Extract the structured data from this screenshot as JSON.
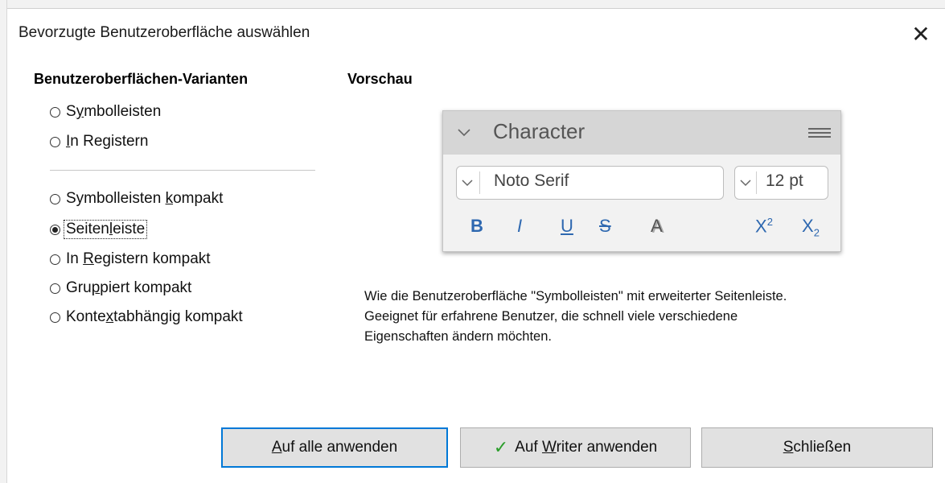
{
  "window": {
    "title": "Bevorzugte Benutzeroberfläche auswählen",
    "close_symbol": "✕"
  },
  "variants": {
    "heading": "Benutzeroberflächen-Varianten",
    "options": [
      {
        "before": "S",
        "key": "y",
        "after": "mbolleisten",
        "checked": false
      },
      {
        "before": "",
        "key": "I",
        "after": "n Registern",
        "checked": false
      },
      {
        "before": "Symbolleisten ",
        "key": "k",
        "after": "ompakt",
        "checked": false
      },
      {
        "before": "Seiten",
        "key": "l",
        "after": "eiste",
        "checked": true
      },
      {
        "before": "In ",
        "key": "R",
        "after": "egistern kompakt",
        "checked": false
      },
      {
        "before": "Gru",
        "key": "p",
        "after": "piert kompakt",
        "checked": false
      },
      {
        "before": "Konte",
        "key": "x",
        "after": "tabhängig kompakt",
        "checked": false
      }
    ]
  },
  "preview": {
    "heading": "Vorschau",
    "panel_title": "Character",
    "font_name": "Noto Serif",
    "font_size": "12 pt",
    "bold": "B",
    "italic": "I",
    "underline": "U",
    "strike": "S",
    "shadow": "A",
    "superscript_base": "X",
    "superscript_exp": "2",
    "subscript_base": "X",
    "subscript_exp": "2",
    "icons": [
      "chevron-down-icon",
      "menu-icon"
    ]
  },
  "description": {
    "line1": "Wie die Benutzeroberfläche \"Symbolleisten\" mit erweiterter Seitenleiste.",
    "line2": "Geeignet für erfahrene Benutzer, die schnell viele verschiedene",
    "line3": "Eigenschaften ändern möchten."
  },
  "buttons": {
    "apply_all": {
      "before": "",
      "key": "A",
      "after": "uf alle anwenden"
    },
    "apply_writer": {
      "before": "Auf ",
      "key": "W",
      "after": "riter anwenden"
    },
    "close": {
      "before": "",
      "key": "S",
      "after": "chließen"
    }
  },
  "colors": {
    "accent": "#0078d7",
    "format_icons": "#2e68b0",
    "check": "#2a9d2a"
  }
}
